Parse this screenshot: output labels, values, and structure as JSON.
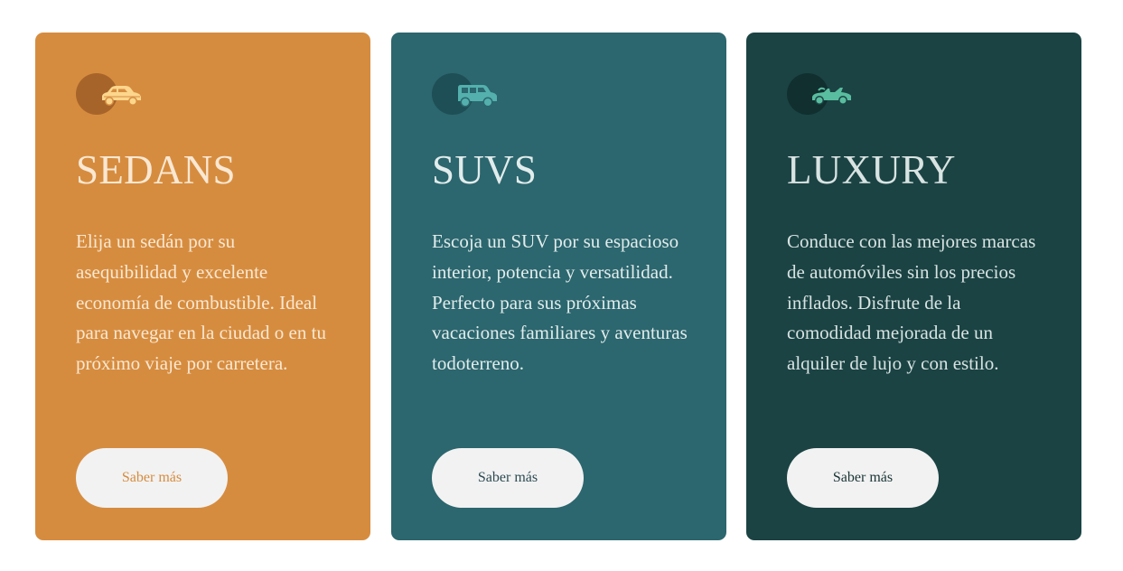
{
  "colors": {
    "sedans_bg": "#d68c3f",
    "suvs_bg": "#2c666e",
    "luxury_bg": "#1b4343",
    "button_bg": "#f2f2f2",
    "sedans_accent": "#fcd68c",
    "suvs_accent": "#53b0ad",
    "luxury_accent": "#59bd9f"
  },
  "cards": [
    {
      "id": "sedans",
      "icon": "sedan-car-icon",
      "title": "SEDANS",
      "description": "Elija un sedán por su asequibilidad y excelente economía de combustible. Ideal para navegar en la ciudad o en tu próximo viaje por carretera.",
      "button_label": "Saber más"
    },
    {
      "id": "suvs",
      "icon": "suv-car-icon",
      "title": "SUVS",
      "description": "Escoja un SUV por su espacioso interior, potencia y versatilidad. Perfecto para sus próximas vacaciones familiares y aventuras todoterreno.",
      "button_label": "Saber más"
    },
    {
      "id": "luxury",
      "icon": "luxury-car-icon",
      "title": "LUXURY",
      "description": "Conduce con las mejores marcas de automóviles sin los precios inflados. Disfrute de la comodidad mejorada de un alquiler de lujo y con estilo.",
      "button_label": "Saber más"
    }
  ]
}
